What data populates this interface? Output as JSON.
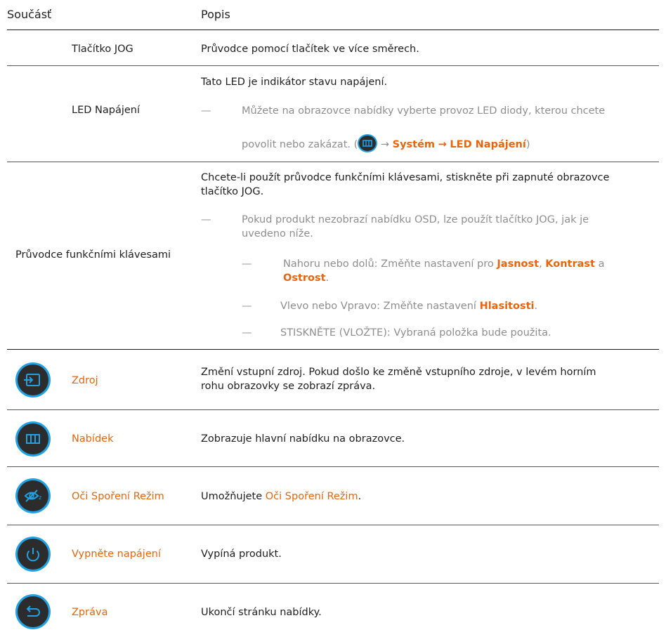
{
  "header": {
    "col_part": "Součásť",
    "col_desc": "Popis"
  },
  "rows": {
    "jog": {
      "name": "Tlačítko JOG",
      "desc": "Průvodce pomocí tlačítek ve více směrech."
    },
    "led": {
      "name": "LED Napájení",
      "desc": "Tato LED je indikátor stavu napájení.",
      "note_line1": "Můžete na obrazovce nabídky vyberte provoz LED diody, kterou chcete",
      "note_line2_start": "povolit nebo zakázat. (",
      "arrow1": "→",
      "sys": "Systém",
      "arrow2": "→",
      "led": "LED Napájení",
      "close": ")"
    },
    "guide": {
      "name": "Průvodce funkčními klávesami",
      "desc_line1": "Chcete-li použít průvodce funkčními klávesami, stiskněte při zapnuté obrazovce",
      "desc_line2": "tlačítko JOG.",
      "note_line1": "Pokud produkt nezobrazí nabídku OSD, lze použít tlačítko JOG, jak je",
      "note_line2": "uvedeno níže.",
      "sub1_start": "Nahoru nebo dolů: Změňte nastavení pro ",
      "jasnost": "Jasnost",
      "comma": ",",
      "kontrast": "Kontrast",
      "a": " a",
      "ostrost": "Ostrost",
      "period1": ".",
      "sub2_start": "Vlevo nebo Vpravo: Změňte nastavení ",
      "hlasitosti": "Hlasitosti",
      "period2": ".",
      "sub3": "STISKNĚTE (VLOŽTE): Vybraná položka bude použita."
    },
    "zdroj": {
      "name": "Zdroj",
      "icon": "input-source-icon",
      "desc_line1": "Změní vstupní zdroj. Pokud došlo ke změně vstupního zdroje, v levém horním",
      "desc_line2": "rohu obrazovky se zobrazí zpráva."
    },
    "menu": {
      "name": "Nabídek",
      "icon": "menu-icon",
      "desc": "Zobrazuje hlavní nabídku na obrazovce."
    },
    "eye": {
      "name": "Oči Spoření Režim",
      "icon": "eye-saver-icon",
      "desc_start": "Umožňujete ",
      "desc_hl": "Oči Spoření Režim",
      "desc_end": "."
    },
    "power": {
      "name": "Vypněte napájení",
      "icon": "power-icon",
      "desc": "Vypíná produkt."
    },
    "back": {
      "name": "Zpráva",
      "icon": "return-icon",
      "desc": "Ukončí stránku nabídky."
    }
  },
  "dash": "—",
  "colors": {
    "accent": "#e8650c",
    "icon_ring": "#1fa3e6",
    "icon_bg": "#2c2c2c"
  }
}
